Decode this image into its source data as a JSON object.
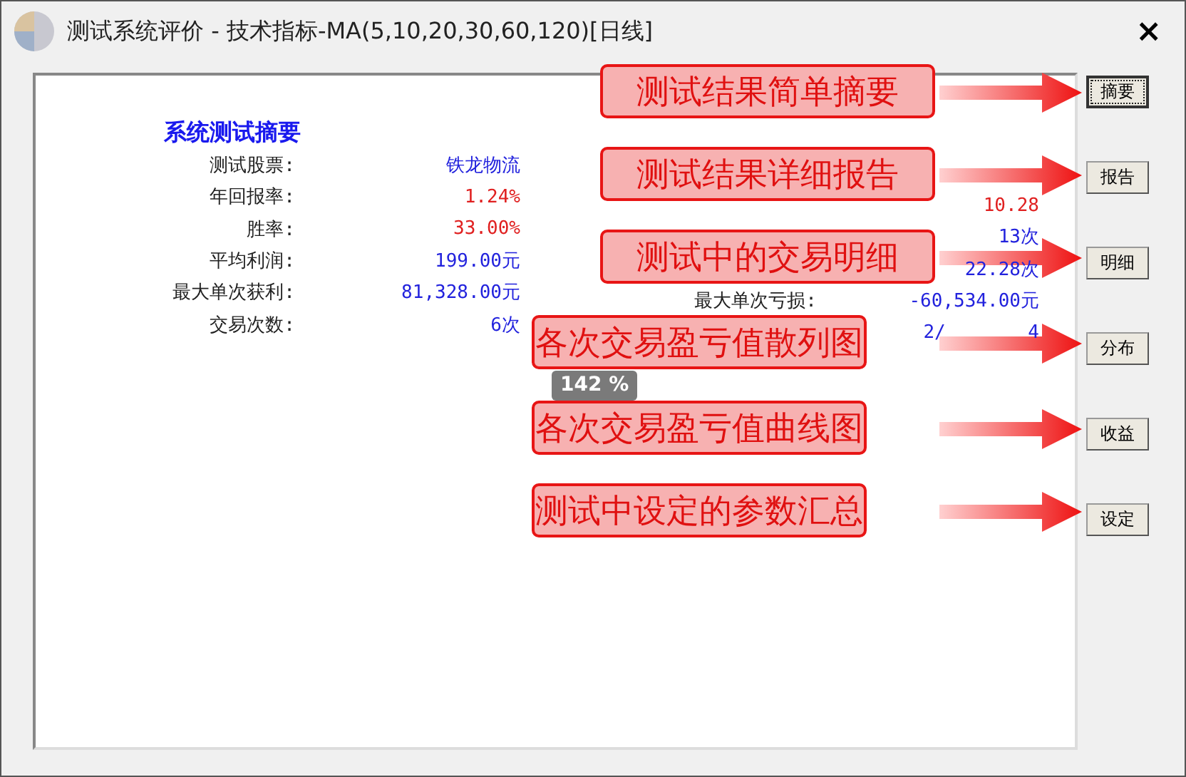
{
  "window": {
    "title": "测试系统评价 - 技术指标-MA(5,10,20,30,60,120)[日线]",
    "close": "×"
  },
  "summary": {
    "title": "系统测试摘要",
    "left_stats": [
      {
        "label": "测试股票:",
        "value": "铁龙物流",
        "color": "#2222dd"
      },
      {
        "label": "年回报率:",
        "value": "1.24%",
        "color": "#e02020"
      },
      {
        "label": "胜率:",
        "value": "33.00%",
        "color": "#e02020"
      },
      {
        "label": "平均利润:",
        "value": "199.00元",
        "color": "#2222dd"
      },
      {
        "label": "最大单次获利:",
        "value": "81,328.00元",
        "color": "#2222dd"
      },
      {
        "label": "交易次数:",
        "value": "6次",
        "color": "#2222dd"
      }
    ],
    "right_stats": [
      {
        "value": "10.28",
        "color": "#e02020"
      },
      {
        "value": "13次",
        "color": "#2222dd"
      },
      {
        "value": "22.28次",
        "color": "#2222dd"
      },
      {
        "label": "最大单次亏损:",
        "value": "-60,534.00元",
        "color": "#2222dd"
      },
      {
        "value": "2/",
        "value_end": "4",
        "color": "#2222dd"
      }
    ]
  },
  "callouts": [
    {
      "text": "测试结果简单摘要"
    },
    {
      "text": "测试结果详细报告"
    },
    {
      "text": "测试中的交易明细"
    },
    {
      "text": "各次交易盈亏值散列图"
    },
    {
      "text": "各次交易盈亏值曲线图"
    },
    {
      "text": "测试中设定的参数汇总"
    }
  ],
  "buttons": [
    {
      "label": "摘要",
      "selected": true
    },
    {
      "label": "报告",
      "selected": false
    },
    {
      "label": "明细",
      "selected": false
    },
    {
      "label": "分布",
      "selected": false
    },
    {
      "label": "收益",
      "selected": false
    },
    {
      "label": "设定",
      "selected": false
    }
  ],
  "zoom_badge": "142 %"
}
